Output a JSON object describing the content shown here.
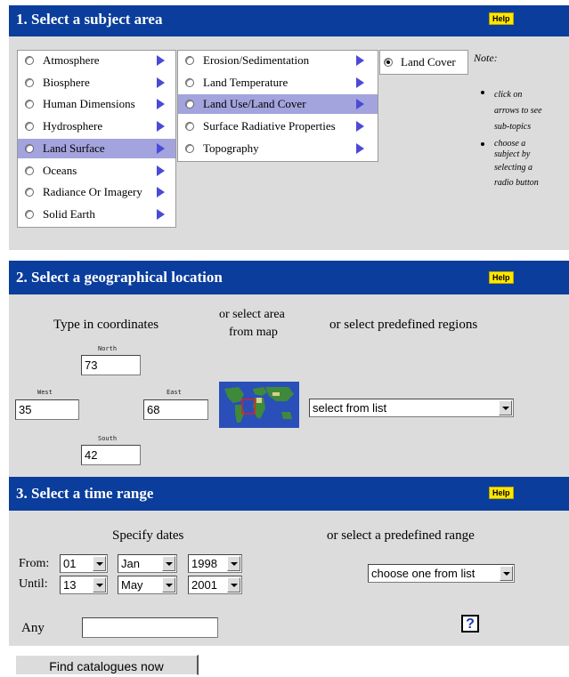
{
  "section1": {
    "title": "1. Select a subject area",
    "help": "Help",
    "topics": [
      "Atmosphere",
      "Biosphere",
      "Human Dimensions",
      "Hydrosphere",
      "Land Surface",
      "Oceans",
      "Radiance Or Imagery",
      "Solid Earth"
    ],
    "subtopics": [
      "Erosion/Sedimentation",
      "Land Temperature",
      "Land Use/Land Cover",
      "Surface Radiative Properties",
      "Topography"
    ],
    "subsubtopics": [
      "Land Cover"
    ],
    "note_title": "Note:",
    "note_1": [
      "click on",
      "arrows to see",
      "sub-topics"
    ],
    "note_2": [
      "choose a",
      "subject by",
      "selecting a",
      "radio button"
    ]
  },
  "section2": {
    "title": "2. Select a geographical location",
    "help": "Help",
    "coords_heading": "Type in coordinates",
    "map_heading_1": "or select area",
    "map_heading_2": "from map",
    "regions_heading": "or select predefined regions",
    "north_label": "North",
    "north": "73",
    "west_label": "West",
    "west": "35",
    "east_label": "East",
    "east": "68",
    "south_label": "South",
    "south": "42",
    "regions_select": "select from list"
  },
  "section3": {
    "title": "3. Select a time range",
    "help": "Help",
    "dates_heading": "Specify dates",
    "range_heading": "or select a predefined range",
    "from_label": "From:",
    "until_label": "Until:",
    "from_day": "01",
    "from_month": "Jan",
    "from_year": "1998",
    "until_day": "13",
    "until_month": "May",
    "until_year": "2001",
    "range_select": "choose one from list",
    "any_label": "Any",
    "any_value": "",
    "help_icon": "?"
  },
  "submit_label": "Find catalogues now"
}
